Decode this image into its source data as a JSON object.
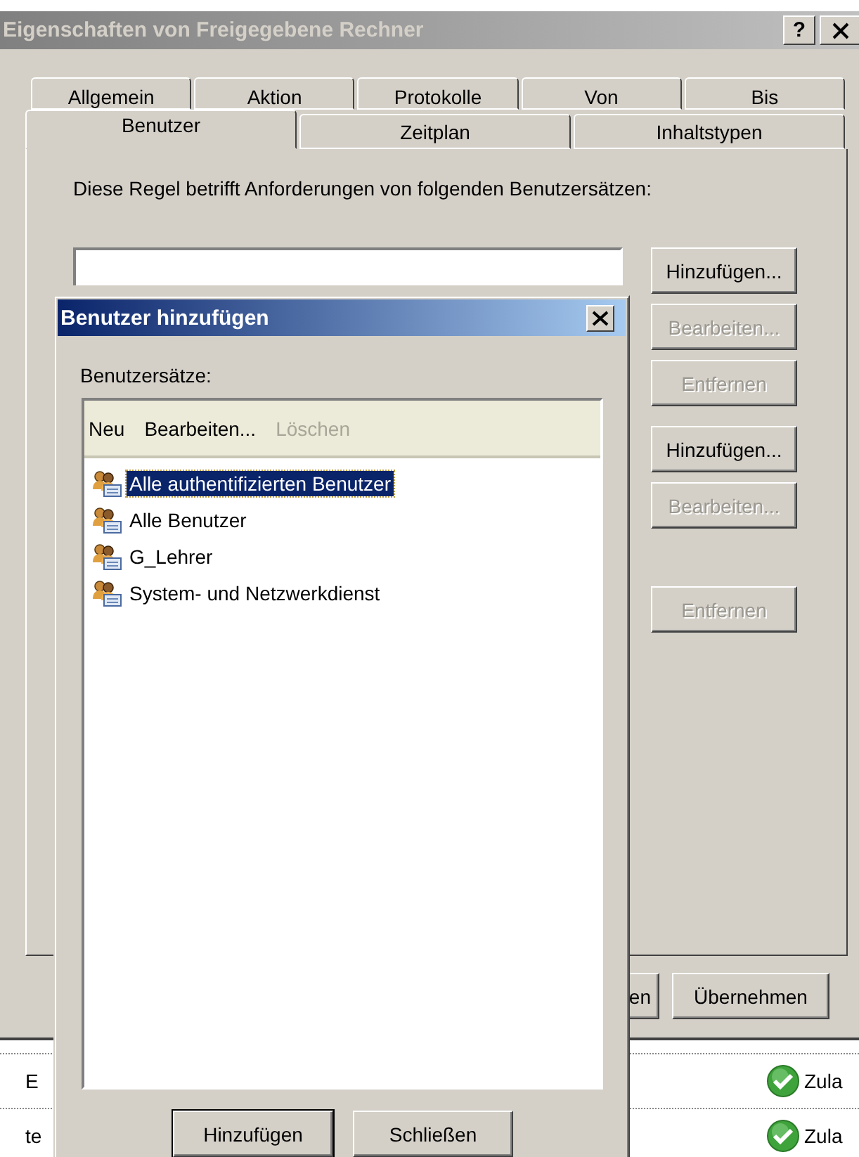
{
  "main_window": {
    "title": "Eigenschaften von Freigegebene Rechner",
    "help_button": "?",
    "tab_rows": [
      {
        "tabs": [
          {
            "label": "Allgemein",
            "selected": false
          },
          {
            "label": "Aktion",
            "selected": false
          },
          {
            "label": "Protokolle",
            "selected": false
          },
          {
            "label": "Von",
            "selected": false
          },
          {
            "label": "Bis",
            "selected": false
          }
        ]
      },
      {
        "tabs": [
          {
            "label": "Benutzer",
            "selected": true
          },
          {
            "label": "Zeitplan",
            "selected": false
          },
          {
            "label": "Inhaltstypen",
            "selected": false
          }
        ]
      }
    ],
    "description": "Diese Regel betrifft Anforderungen von folgenden Benutzersätzen:",
    "button_groups": [
      {
        "buttons": [
          {
            "label": "Hinzufügen...",
            "disabled": false
          },
          {
            "label": "Bearbeiten...",
            "disabled": true
          },
          {
            "label": "Entfernen",
            "disabled": true
          }
        ]
      },
      {
        "buttons": [
          {
            "label": "Hinzufügen...",
            "disabled": false
          },
          {
            "label": "Bearbeiten...",
            "disabled": true
          },
          {
            "label": "Entfernen",
            "disabled": true
          }
        ]
      }
    ],
    "footer_buttons": [
      {
        "label": "en"
      },
      {
        "label": "Übernehmen"
      }
    ]
  },
  "background_list": {
    "rows": [
      {
        "column_1": "E",
        "status": "Zula"
      },
      {
        "column_1": "te",
        "status": "Zula"
      }
    ]
  },
  "dialog": {
    "title": "Benutzer hinzufügen",
    "list_label": "Benutzersätze:",
    "toolbar": [
      {
        "label": "Neu",
        "disabled": false
      },
      {
        "label": "Bearbeiten...",
        "disabled": false
      },
      {
        "label": "Löschen",
        "disabled": true
      }
    ],
    "items": [
      {
        "label": "Alle authentifizierten Benutzer",
        "selected": true
      },
      {
        "label": "Alle Benutzer",
        "selected": false
      },
      {
        "label": "G_Lehrer",
        "selected": false
      },
      {
        "label": "System- und Netzwerkdienst",
        "selected": false
      }
    ],
    "buttons": [
      {
        "label": "Hinzufügen",
        "default": true
      },
      {
        "label": "Schließen",
        "default": false
      }
    ]
  }
}
